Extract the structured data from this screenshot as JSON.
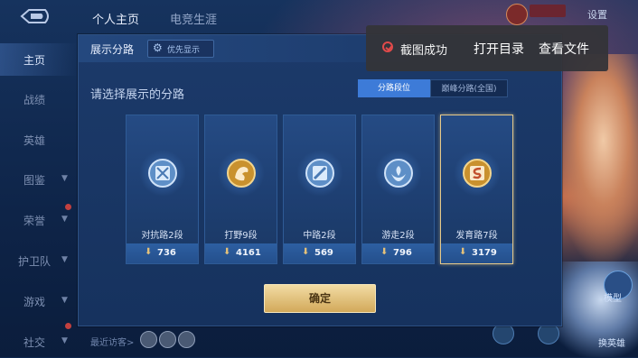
{
  "topbar": {
    "tabs": [
      {
        "label": "个人主页"
      },
      {
        "label": "电竞生涯"
      }
    ],
    "settings_label": "设置"
  },
  "sidebar": {
    "items": [
      {
        "label": "主页"
      },
      {
        "label": "战绩"
      },
      {
        "label": "英雄"
      },
      {
        "label": "图鉴"
      },
      {
        "label": "荣誉"
      },
      {
        "label": "护卫队"
      },
      {
        "label": "游戏"
      },
      {
        "label": "社交"
      }
    ]
  },
  "panel": {
    "title": "展示分路",
    "preference_button": "优先显示",
    "heading": "请选择展示的分路",
    "segments": [
      {
        "label": "分路段位"
      },
      {
        "label": "巅峰分路(全国)"
      }
    ],
    "lanes": [
      {
        "name": "对抗路2段",
        "points": "736",
        "icon": "sword-shield-emblem-icon"
      },
      {
        "name": "打野9段",
        "points": "4161",
        "icon": "dragon-emblem-icon"
      },
      {
        "name": "中路2段",
        "points": "569",
        "icon": "magic-wand-emblem-icon"
      },
      {
        "name": "游走2段",
        "points": "796",
        "icon": "support-emblem-icon"
      },
      {
        "name": "发育路7段",
        "points": "3179",
        "icon": "marksman-emblem-icon"
      }
    ],
    "confirm_label": "确定"
  },
  "toast": {
    "message": "截图成功",
    "open_dir": "打开目录",
    "view_file": "查看文件"
  },
  "bottom": {
    "recent_visitors": "最近访客>"
  },
  "right": {
    "model_label": "模型",
    "hero_label": "换英雄"
  },
  "colors": {
    "accent_blue": "#3d7bd8",
    "gold": "#d2a95a",
    "selected_border": "#e5c98a",
    "toast_icon_red": "#e14a4a"
  }
}
